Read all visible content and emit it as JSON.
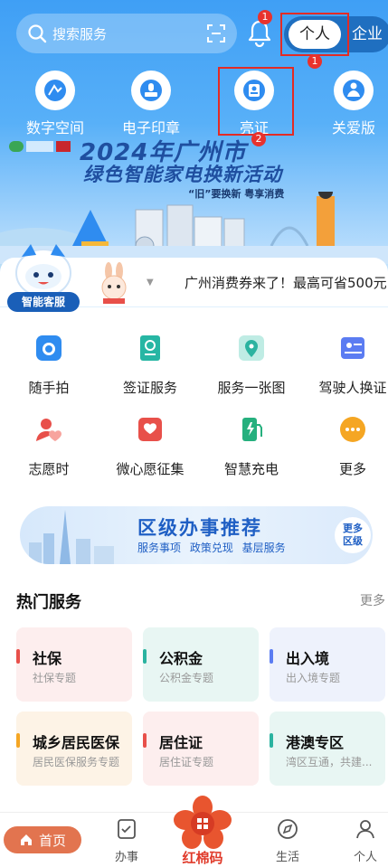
{
  "header": {
    "search_placeholder": "搜索服务",
    "bell_badge": "1",
    "toggle_personal": "个人",
    "toggle_enterprise": "企业",
    "highlight_badge_1": "1",
    "highlight_badge_2": "2"
  },
  "quick_actions": [
    {
      "label": "数字空间",
      "icon": "digital-space-icon"
    },
    {
      "label": "电子印章",
      "icon": "seal-icon"
    },
    {
      "label": "亮证",
      "icon": "certificate-icon"
    },
    {
      "label": "关爱版",
      "icon": "care-icon"
    }
  ],
  "banner": {
    "title_line1": "2024年广州市",
    "title_line2": "绿色智能家电换新活动",
    "subtitle": "“旧”要换新 粤享消费"
  },
  "ticker": {
    "robot_label": "智能客服",
    "text": "广州消费券来了！最高可省500元"
  },
  "services": [
    {
      "label": "随手拍",
      "icon": "camera-icon",
      "color": "#2f8cf0"
    },
    {
      "label": "签证服务",
      "icon": "passport-icon",
      "color": "#27b6a4"
    },
    {
      "label": "服务一张图",
      "icon": "map-pin-icon",
      "color": "#2bb3a0"
    },
    {
      "label": "驾驶人换证",
      "icon": "driver-card-icon",
      "color": "#5b7cf2"
    },
    {
      "label": "志愿时",
      "icon": "volunteer-icon",
      "color": "#e8504a"
    },
    {
      "label": "微心愿征集",
      "icon": "wish-icon",
      "color": "#e8504a"
    },
    {
      "label": "智慧充电",
      "icon": "charging-icon",
      "color": "#26b07e"
    },
    {
      "label": "更多",
      "icon": "more-icon",
      "color": "#f5a623"
    }
  ],
  "district": {
    "title": "区级办事推荐",
    "tags": "服务事项 政策兑现 基层服务",
    "more_line1": "更多",
    "more_line2": "区级"
  },
  "hot": {
    "title": "热门服务",
    "more": "更多",
    "cards": [
      {
        "title": "社保",
        "subtitle": "社保专题",
        "bg": "#fdeeee",
        "accent": "#e8504a"
      },
      {
        "title": "公积金",
        "subtitle": "公积金专题",
        "bg": "#e8f6f3",
        "accent": "#2bb3a0"
      },
      {
        "title": "出入境",
        "subtitle": "出入境专题",
        "bg": "#eef2fc",
        "accent": "#5b7cf2"
      },
      {
        "title": "城乡居民医保",
        "subtitle": "居民医保服务专题",
        "bg": "#fdf3e6",
        "accent": "#f5a623"
      },
      {
        "title": "居住证",
        "subtitle": "居住证专题",
        "bg": "#fdeeee",
        "accent": "#e8504a"
      },
      {
        "title": "港澳专区",
        "subtitle": "湾区互通，共建...",
        "bg": "#e8f6f3",
        "accent": "#2bb3a0"
      }
    ]
  },
  "tabbar": {
    "home": "首页",
    "tasks": "办事",
    "center": "红棉码",
    "life": "生活",
    "personal": "个人"
  }
}
